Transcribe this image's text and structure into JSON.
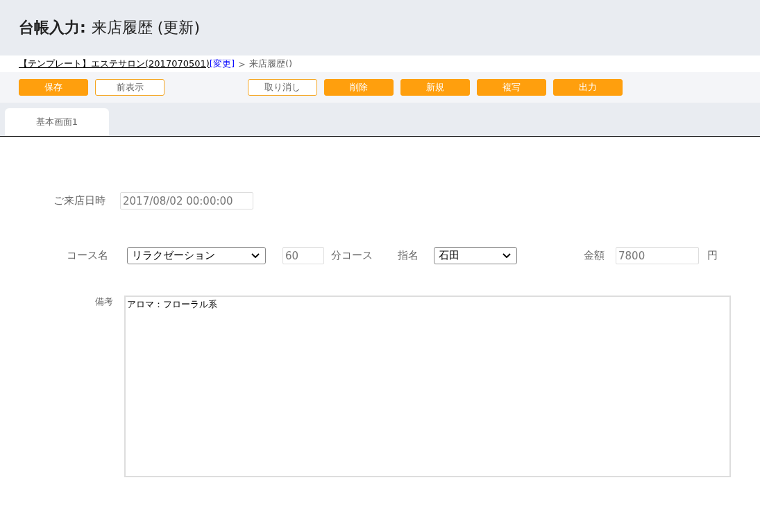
{
  "header": {
    "title_bold": "台帳入力:",
    "title": "来店履歴 (更新)"
  },
  "breadcrumb": {
    "link": "【テンプレート】エステサロン(2017070501)",
    "change_link": "[変更]",
    "separator": ">",
    "current": "来店履歴()"
  },
  "toolbar": {
    "left_buttons": [
      {
        "label": "保存",
        "kind": "primary"
      },
      {
        "label": "前表示",
        "kind": "outline"
      }
    ],
    "right_buttons": [
      {
        "label": "取り消し",
        "kind": "outline"
      },
      {
        "label": "削除",
        "kind": "primary"
      },
      {
        "label": "新規",
        "kind": "primary"
      },
      {
        "label": "複写",
        "kind": "primary"
      },
      {
        "label": "出力",
        "kind": "primary"
      }
    ]
  },
  "tabs": [
    {
      "label": "基本画面1",
      "selected": true
    }
  ],
  "form": {
    "visit_datetime": {
      "label": "ご来店日時",
      "value": "2017/08/02 00:00:00"
    },
    "course": {
      "label": "コース名",
      "value": "リラクゼーション",
      "minutes": "60",
      "minutes_unit": "分コース"
    },
    "nomination": {
      "label": "指名",
      "value": "石田"
    },
    "amount": {
      "label": "金額",
      "value": "7800",
      "unit": "円"
    },
    "remarks": {
      "label": "備考",
      "value": "アロマ：フローラル系"
    }
  }
}
